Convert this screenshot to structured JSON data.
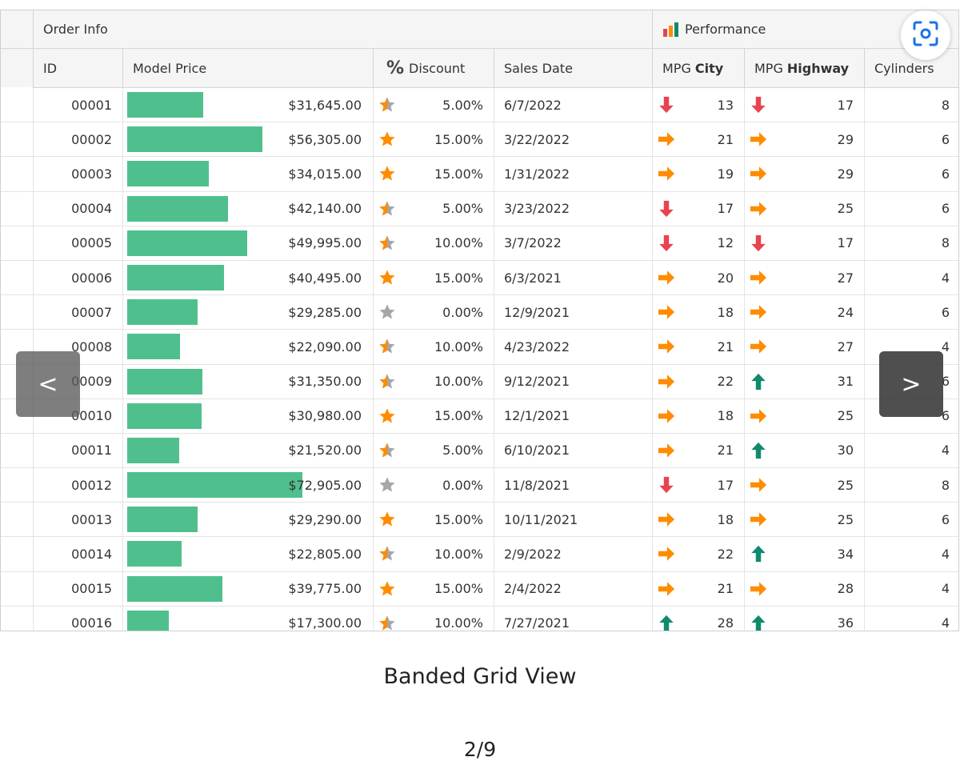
{
  "grid": {
    "bands": {
      "order_info": "Order Info",
      "performance": "Performance"
    },
    "columns": {
      "id": "ID",
      "model_price": "Model Price",
      "discount": "Discount",
      "sales_date": "Sales Date",
      "mpg_city_prefix": "MPG",
      "mpg_city_bold": "City",
      "mpg_highway_prefix": "MPG",
      "mpg_highway_bold": "Highway",
      "cylinders": "Cylinders"
    },
    "rows": [
      {
        "id": "00001",
        "price": "$31,645.00",
        "price_value": 31645,
        "discount_icon": "star-half-icon",
        "discount": "5.00%",
        "date": "6/7/2022",
        "city_icon": "arrow-down-icon",
        "city": "13",
        "hwy_icon": "arrow-down-icon",
        "hwy": "17",
        "cyl": "8"
      },
      {
        "id": "00002",
        "price": "$56,305.00",
        "price_value": 56305,
        "discount_icon": "star-full-icon",
        "discount": "15.00%",
        "date": "3/22/2022",
        "city_icon": "arrow-right-icon",
        "city": "21",
        "hwy_icon": "arrow-right-icon",
        "hwy": "29",
        "cyl": "6"
      },
      {
        "id": "00003",
        "price": "$34,015.00",
        "price_value": 34015,
        "discount_icon": "star-full-icon",
        "discount": "15.00%",
        "date": "1/31/2022",
        "city_icon": "arrow-right-icon",
        "city": "19",
        "hwy_icon": "arrow-right-icon",
        "hwy": "29",
        "cyl": "6"
      },
      {
        "id": "00004",
        "price": "$42,140.00",
        "price_value": 42140,
        "discount_icon": "star-half-icon",
        "discount": "5.00%",
        "date": "3/23/2022",
        "city_icon": "arrow-down-icon",
        "city": "17",
        "hwy_icon": "arrow-right-icon",
        "hwy": "25",
        "cyl": "6"
      },
      {
        "id": "00005",
        "price": "$49,995.00",
        "price_value": 49995,
        "discount_icon": "star-half-icon",
        "discount": "10.00%",
        "date": "3/7/2022",
        "city_icon": "arrow-down-icon",
        "city": "12",
        "hwy_icon": "arrow-down-icon",
        "hwy": "17",
        "cyl": "8"
      },
      {
        "id": "00006",
        "price": "$40,495.00",
        "price_value": 40495,
        "discount_icon": "star-full-icon",
        "discount": "15.00%",
        "date": "6/3/2021",
        "city_icon": "arrow-right-icon",
        "city": "20",
        "hwy_icon": "arrow-right-icon",
        "hwy": "27",
        "cyl": "4"
      },
      {
        "id": "00007",
        "price": "$29,285.00",
        "price_value": 29285,
        "discount_icon": "star-empty-icon",
        "discount": "0.00%",
        "date": "12/9/2021",
        "city_icon": "arrow-right-icon",
        "city": "18",
        "hwy_icon": "arrow-right-icon",
        "hwy": "24",
        "cyl": "6"
      },
      {
        "id": "00008",
        "price": "$22,090.00",
        "price_value": 22090,
        "discount_icon": "star-half-icon",
        "discount": "10.00%",
        "date": "4/23/2022",
        "city_icon": "arrow-right-icon",
        "city": "21",
        "hwy_icon": "arrow-right-icon",
        "hwy": "27",
        "cyl": "4"
      },
      {
        "id": "00009",
        "price": "$31,350.00",
        "price_value": 31350,
        "discount_icon": "star-half-icon",
        "discount": "10.00%",
        "date": "9/12/2021",
        "city_icon": "arrow-right-icon",
        "city": "22",
        "hwy_icon": "arrow-up-icon",
        "hwy": "31",
        "cyl": "6"
      },
      {
        "id": "00010",
        "price": "$30,980.00",
        "price_value": 30980,
        "discount_icon": "star-full-icon",
        "discount": "15.00%",
        "date": "12/1/2021",
        "city_icon": "arrow-right-icon",
        "city": "18",
        "hwy_icon": "arrow-right-icon",
        "hwy": "25",
        "cyl": "6"
      },
      {
        "id": "00011",
        "price": "$21,520.00",
        "price_value": 21520,
        "discount_icon": "star-half-icon",
        "discount": "5.00%",
        "date": "6/10/2021",
        "city_icon": "arrow-right-icon",
        "city": "21",
        "hwy_icon": "arrow-up-icon",
        "hwy": "30",
        "cyl": "4"
      },
      {
        "id": "00012",
        "price": "$72,905.00",
        "price_value": 72905,
        "discount_icon": "star-empty-icon",
        "discount": "0.00%",
        "date": "11/8/2021",
        "city_icon": "arrow-down-icon",
        "city": "17",
        "hwy_icon": "arrow-right-icon",
        "hwy": "25",
        "cyl": "8"
      },
      {
        "id": "00013",
        "price": "$29,290.00",
        "price_value": 29290,
        "discount_icon": "star-full-icon",
        "discount": "15.00%",
        "date": "10/11/2021",
        "city_icon": "arrow-right-icon",
        "city": "18",
        "hwy_icon": "arrow-right-icon",
        "hwy": "25",
        "cyl": "6"
      },
      {
        "id": "00014",
        "price": "$22,805.00",
        "price_value": 22805,
        "discount_icon": "star-half-icon",
        "discount": "10.00%",
        "date": "2/9/2022",
        "city_icon": "arrow-right-icon",
        "city": "22",
        "hwy_icon": "arrow-up-icon",
        "hwy": "34",
        "cyl": "4"
      },
      {
        "id": "00015",
        "price": "$39,775.00",
        "price_value": 39775,
        "discount_icon": "star-full-icon",
        "discount": "15.00%",
        "date": "2/4/2022",
        "city_icon": "arrow-right-icon",
        "city": "21",
        "hwy_icon": "arrow-right-icon",
        "hwy": "28",
        "cyl": "4"
      },
      {
        "id": "00016",
        "price": "$17,300.00",
        "price_value": 17300,
        "discount_icon": "star-half-icon",
        "discount": "10.00%",
        "date": "7/27/2021",
        "city_icon": "arrow-up-icon",
        "city": "28",
        "hwy_icon": "arrow-up-icon",
        "hwy": "36",
        "cyl": "4"
      }
    ]
  },
  "colors": {
    "data_bar": "#4fc08d",
    "star_orange": "#ff8c00",
    "star_gray": "#a6a6a6",
    "arrow_down": "#e8434f",
    "arrow_right": "#ff8c00",
    "arrow_up": "#0f8a6d",
    "scan_icon": "#1a73e8"
  },
  "nav": {
    "prev": "<",
    "next": ">"
  },
  "scan_button_icon": "scan-text-icon",
  "caption": "Banded Grid View",
  "pager": "2/9"
}
